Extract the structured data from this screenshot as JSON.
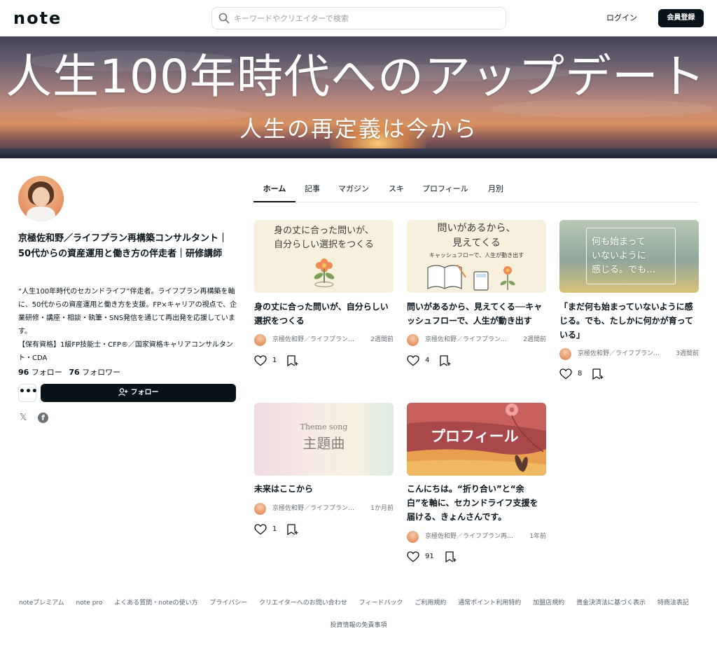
{
  "header": {
    "logo": "note",
    "search_placeholder": "キーワードやクリエイターで検索",
    "login": "ログイン",
    "signup": "会員登録"
  },
  "banner": {
    "title": "人生100年時代へのアップデート",
    "subtitle": "人生の再定義は今から"
  },
  "profile": {
    "name": "京極佐和野／ライフプラン再構築コンサルタント｜50代からの資産運用と働き方の伴走者｜研修講師",
    "bio": "“人生100年時代のセカンドライフ”伴走者。ライフプラン再構築を軸に、50代からの資産運用と働き方を支援。FP×キャリアの視点で、企業研修・講座・相談・執筆・SNS発信を通じて再出発を応援しています。\n【保有資格】1級FP技能士・CFP®／国家資格キャリアコンサルタント・CDA",
    "follow_count": "96",
    "follow_label": "フォロー",
    "follower_count": "76",
    "follower_label": "フォロワー",
    "more_label": "•••",
    "follow_button": "フォロー"
  },
  "tabs": [
    "ホーム",
    "記事",
    "マガジン",
    "スキ",
    "プロフィール",
    "月別"
  ],
  "active_tab": "ホーム",
  "cards": [
    {
      "thumb_text": "身の丈に合った問いが、\n自分らしい選択をつくる",
      "title": "身の丈に合った問いが、自分らしい選択をつくる",
      "author": "京極佐和野／ライフプラン…",
      "date": "2週間前",
      "likes": "1"
    },
    {
      "thumb_text": "問いがあるから、\n見えてくる",
      "thumb_sub": "キャッシュフローで、人生が動き出す",
      "title": "問いがあるから、見えてくる──キャッシュフローで、人生が動き出す",
      "author": "京極佐和野／ライフプラン…",
      "date": "2週間前",
      "likes": "4"
    },
    {
      "thumb_text": "何も始まって\nいないように\n感じる。でも…",
      "title": "「まだ何も始まっていないように感じる。でも、たしかに何かが育っている」",
      "author": "京極佐和野／ライフプラン…",
      "date": "3週間前",
      "likes": "8"
    },
    {
      "thumb_en": "Theme song",
      "thumb_text": "主題曲",
      "title": "未来はここから",
      "author": "京極佐和野／ライフプラン…",
      "date": "1か月前",
      "likes": "1"
    },
    {
      "thumb_text": "プロフィール",
      "title": "こんにちは。“折り合い”と“余白”を軸に、セカンドライフ支援を届ける、きょんさんです。",
      "author": "京極佐和野／ライフプラン再…",
      "date": "1年前",
      "likes": "91"
    }
  ],
  "footer": {
    "links": [
      "noteプレミアム",
      "note pro",
      "よくある質問・noteの使い方",
      "プライバシー",
      "クリエイターへのお問い合わせ",
      "フィードバック",
      "ご利用規約",
      "通常ポイント利用特約",
      "加盟店規約",
      "資金決済法に基づく表示",
      "特商法表記"
    ],
    "disclaimer": "投資情報の免責事項"
  },
  "colors": {
    "text": "#08131a",
    "muted": "#6b7176",
    "button": "#08131a",
    "border": "#dde0e2"
  }
}
